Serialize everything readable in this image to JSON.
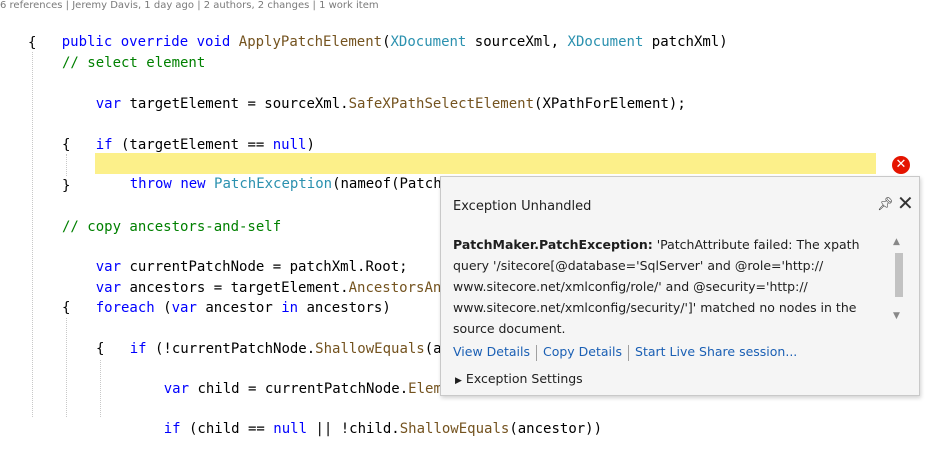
{
  "codelens": "6 references | Jeremy Davis, 1 day ago | 2 authors, 2 changes | 1 work item",
  "code": {
    "l1": {
      "kw1": "public",
      "kw2": "override",
      "kw3": "void",
      "method": "ApplyPatchElement",
      "p1": "(",
      "t1": "XDocument",
      "v1": " sourceXml, ",
      "t2": "XDocument",
      "v2": " patchXml)"
    },
    "l2": "{",
    "l3": "// select element",
    "l4": {
      "kw": "var",
      "a": " targetElement = sourceXml.",
      "m": "SafeXPathSelectElement",
      "b": "(XPathForElement);"
    },
    "l5": {
      "kw": "if",
      "a": " (targetElement == ",
      "kw2": "null",
      "b": ")"
    },
    "l6": "{",
    "l7": {
      "kw": "throw",
      "kw2": "new",
      "t": "PatchException",
      "a": "(nameof(PatchAttribute), XPathForElement, nameof(XPathForElement));"
    },
    "l8": "}",
    "l9": "// copy ancestors-and-self",
    "l10": {
      "kw": "var",
      "a": " currentPatchNode = patchXml.Root;"
    },
    "l11": {
      "kw": "var",
      "a": " ancestors = targetElement.",
      "m": "AncestorsAndSe"
    },
    "l12": {
      "kw": "foreach",
      "a": " (",
      "kw2": "var",
      "b": " ancestor ",
      "kw3": "in",
      "c": " ancestors)"
    },
    "l13": "{",
    "l14": {
      "kw": "if",
      "a": " (!currentPatchNode.",
      "m": "ShallowEquals",
      "b": "(ance"
    },
    "l15": "{",
    "l16": {
      "kw": "var",
      "a": " child = currentPatchNode.",
      "m": "Element"
    },
    "l17": {
      "kw": "if",
      "a": " (child == ",
      "kw2": "null",
      "b": " || !child.",
      "m": "ShallowEquals",
      "c": "(ancestor))"
    }
  },
  "popup": {
    "title": "Exception Unhandled",
    "exception_type": "PatchMaker.PatchException:",
    "message_lines": [
      " 'PatchAttribute failed: The xpath",
      "query '/sitecore[@database='SqlServer' and @role='http://",
      "www.sitecore.net/xmlconfig/role/' and @security='http://",
      "www.sitecore.net/xmlconfig/security/']' matched no nodes in the",
      "source document."
    ],
    "links": {
      "view": "View Details",
      "copy": "Copy Details",
      "share": "Start Live Share session..."
    },
    "settings": "Exception Settings"
  },
  "colors": {
    "keyword": "#0000ff",
    "type": "#2b91af",
    "comment": "#008000",
    "highlight": "#fcf08a",
    "error": "#e51400",
    "link": "#1a5fb4"
  }
}
